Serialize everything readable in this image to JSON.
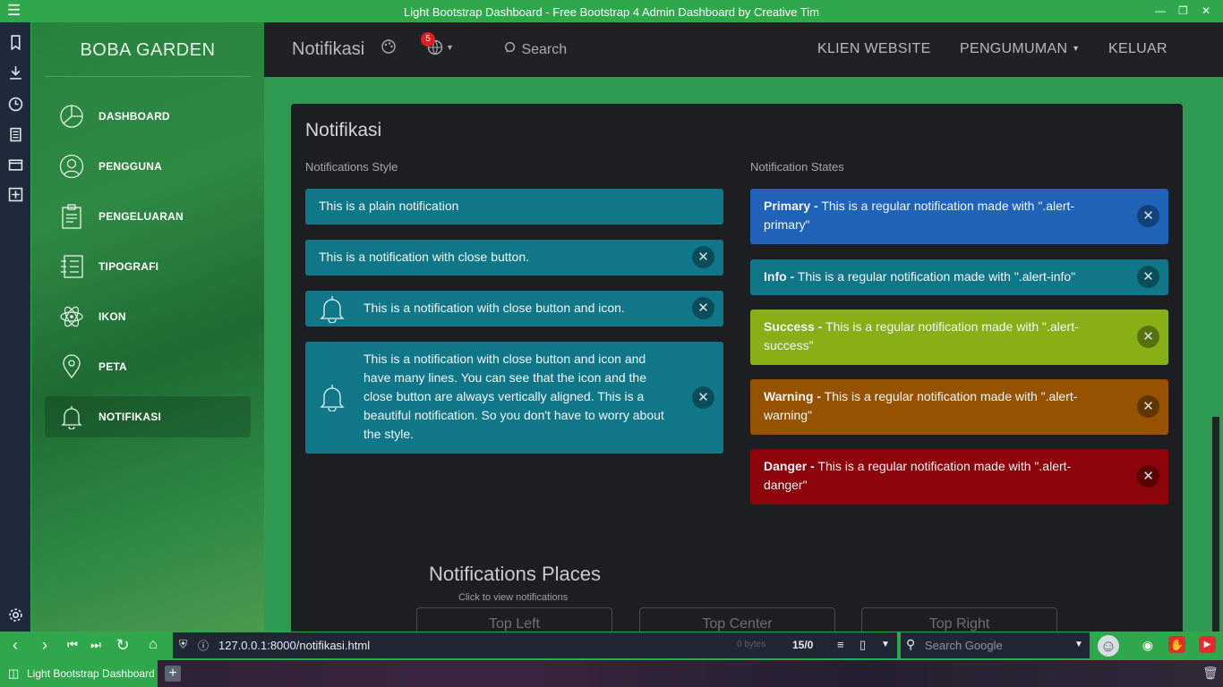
{
  "window": {
    "title": "Light Bootstrap Dashboard - Free Bootstrap 4 Admin Dashboard by Creative Tim"
  },
  "sidebar": {
    "brand": "BOBA GARDEN",
    "items": [
      {
        "label": "DASHBOARD",
        "icon": "chart-pie-icon"
      },
      {
        "label": "PENGGUNA",
        "icon": "user-circle-icon"
      },
      {
        "label": "PENGELUARAN",
        "icon": "clipboard-icon"
      },
      {
        "label": "TIPOGRAFI",
        "icon": "notes-icon"
      },
      {
        "label": "IKON",
        "icon": "atom-icon"
      },
      {
        "label": "PETA",
        "icon": "map-pin-icon"
      },
      {
        "label": "NOTIFIKASI",
        "icon": "bell-icon"
      }
    ]
  },
  "topnav": {
    "title": "Notifikasi",
    "badge_count": "5",
    "search_label": "Search",
    "links": [
      "KLIEN WEBSITE",
      "PENGUMUMAN",
      "KELUAR"
    ]
  },
  "card": {
    "title": "Notifikasi",
    "style_heading": "Notifications Style",
    "states_heading": "Notification States",
    "style_alerts": [
      "This is a plain notification",
      "This is a notification with close button.",
      "This is a notification with close button and icon.",
      "This is a notification with close button and icon and have many lines. You can see that the icon and the close button are always vertically aligned. This is a beautiful notification. So you don't have to worry about the style."
    ],
    "state_alerts": [
      {
        "bold": "Primary -",
        "text": " This is a regular notification made with \".alert-primary\"",
        "color": "#1e63b8"
      },
      {
        "bold": "Info -",
        "text": " This is a regular notification made with \".alert-info\"",
        "color": "#107788"
      },
      {
        "bold": "Success -",
        "text": " This is a regular notification made with \".alert-success\"",
        "color": "#86b015"
      },
      {
        "bold": "Warning -",
        "text": " This is a regular notification made with \".alert-warning\"",
        "color": "#975200"
      },
      {
        "bold": "Danger -",
        "text": " This is a regular notification made with \".alert-danger\"",
        "color": "#8c0309"
      }
    ],
    "places_heading": "Notifications Places",
    "places_hint": "Click to view notifications",
    "places_buttons": [
      "Top Left",
      "Top Center",
      "Top Right"
    ]
  },
  "browser": {
    "url": "127.0.0.1:8000/notifikasi.html",
    "bytes": "0 bytes",
    "counter": "15/0",
    "search_placeholder": "Search Google",
    "tab_title": "Light Bootstrap Dashboard"
  },
  "colors": {
    "accent": "#2ea84a",
    "info": "#107788"
  }
}
